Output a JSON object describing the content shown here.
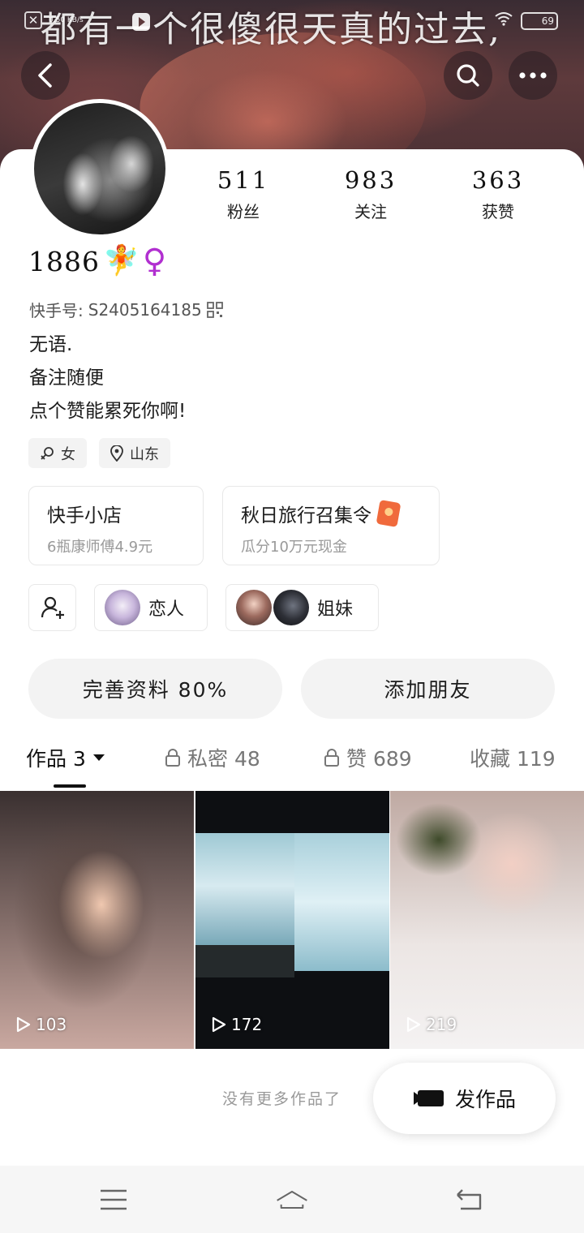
{
  "header": {
    "banner_text": "都有一个很傻很天真的过去,",
    "status": {
      "speed": "0.50 KB/s",
      "battery": "69"
    }
  },
  "profile": {
    "username": "1886",
    "emoji_fairy": "🧚",
    "emoji_female": "♀",
    "kuaishou_id_label": "快手号:",
    "kuaishou_id": "S2405164185",
    "bio_lines": [
      "无语.",
      "备注随便",
      "点个赞能累死你啊!"
    ],
    "tags": {
      "gender": "女",
      "location": "山东"
    }
  },
  "stats": [
    {
      "value": "511",
      "label": "粉丝"
    },
    {
      "value": "983",
      "label": "关注"
    },
    {
      "value": "363",
      "label": "获赞"
    }
  ],
  "promos": [
    {
      "title": "快手小店",
      "subtitle": "6瓶康师傅4.9元"
    },
    {
      "title": "秋日旅行召集令",
      "subtitle": "瓜分10万元现金"
    }
  ],
  "relations": [
    {
      "label": "恋人"
    },
    {
      "label": "姐妹"
    }
  ],
  "actions": {
    "complete_profile": "完善资料 80%",
    "add_friend": "添加朋友"
  },
  "tabs": [
    {
      "label": "作品 3"
    },
    {
      "label": "私密 48"
    },
    {
      "label": "赞 689"
    },
    {
      "label": "收藏 119"
    }
  ],
  "works": [
    {
      "plays": "103"
    },
    {
      "plays": "172"
    },
    {
      "plays": "219"
    }
  ],
  "footer": {
    "no_more": "没有更多作品了",
    "post_label": "发作品"
  }
}
